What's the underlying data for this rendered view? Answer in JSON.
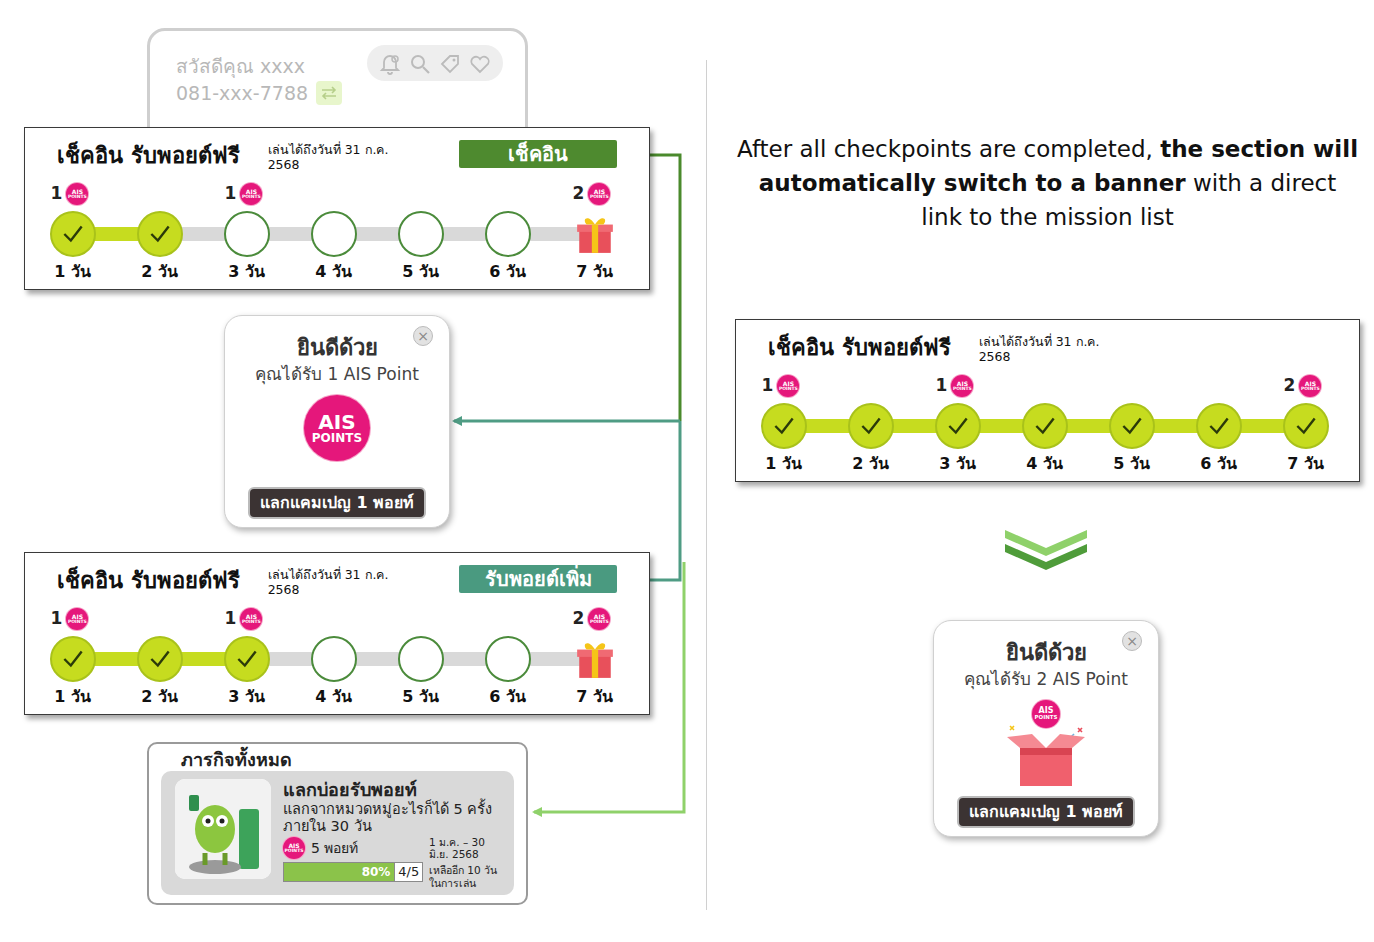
{
  "header": {
    "greeting": "สวัสดีคุณ xxxx",
    "phone": "081-xxx-7788"
  },
  "badge": {
    "line1": "AIS",
    "line2": "POINTS"
  },
  "checkin_cards": [
    {
      "title": "เช็คอิน รับพอยต์ฟรี",
      "note": "เล่นได้ถึงวันที่ 31 ก.ค. 2568",
      "button": "เช็คอิน",
      "button_color": "#4e8a2f",
      "days": [
        {
          "label": "1 วัน",
          "points": "1",
          "done": true,
          "kind": "step"
        },
        {
          "label": "2 วัน",
          "done": true,
          "kind": "step"
        },
        {
          "label": "3 วัน",
          "points": "1",
          "done": false,
          "kind": "step"
        },
        {
          "label": "4 วัน",
          "done": false,
          "kind": "step"
        },
        {
          "label": "5 วัน",
          "done": false,
          "kind": "step"
        },
        {
          "label": "6 วัน",
          "done": false,
          "kind": "step"
        },
        {
          "label": "7 วัน",
          "points": "2",
          "done": false,
          "kind": "gift"
        }
      ]
    },
    {
      "title": "เช็คอิน รับพอยต์ฟรี",
      "note": "เล่นได้ถึงวันที่ 31 ก.ค. 2568",
      "button": "รับพอยต์เพิ่ม",
      "button_color": "#4a9a80",
      "days": [
        {
          "label": "1 วัน",
          "points": "1",
          "done": true,
          "kind": "step"
        },
        {
          "label": "2 วัน",
          "done": true,
          "kind": "step"
        },
        {
          "label": "3 วัน",
          "points": "1",
          "done": true,
          "kind": "step"
        },
        {
          "label": "4 วัน",
          "done": false,
          "kind": "step"
        },
        {
          "label": "5 วัน",
          "done": false,
          "kind": "step"
        },
        {
          "label": "6 วัน",
          "done": false,
          "kind": "step"
        },
        {
          "label": "7 วัน",
          "points": "2",
          "done": false,
          "kind": "gift"
        }
      ]
    },
    {
      "title": "เช็คอิน รับพอยต์ฟรี",
      "note": "เล่นได้ถึงวันที่ 31 ก.ค. 2568",
      "days": [
        {
          "label": "1 วัน",
          "points": "1",
          "done": true,
          "kind": "step"
        },
        {
          "label": "2 วัน",
          "done": true,
          "kind": "step"
        },
        {
          "label": "3 วัน",
          "points": "1",
          "done": true,
          "kind": "step"
        },
        {
          "label": "4 วัน",
          "done": true,
          "kind": "step"
        },
        {
          "label": "5 วัน",
          "done": true,
          "kind": "step"
        },
        {
          "label": "6 วัน",
          "done": true,
          "kind": "step"
        },
        {
          "label": "7 วัน",
          "points": "2",
          "done": true,
          "kind": "step"
        }
      ]
    }
  ],
  "popups": [
    {
      "title": "ยินดีด้วย",
      "message": "คุณได้รับ 1 AIS Point",
      "button": "แลกแคมเปญ 1 พอยท์",
      "close": "×",
      "kind": "coin"
    },
    {
      "title": "ยินดีด้วย",
      "message": "คุณได้รับ 2 AIS Point",
      "button": "แลกแคมเปญ 1 พอยท์",
      "close": "×",
      "kind": "gift"
    }
  ],
  "missions": {
    "heading": "ภารกิจทั้งหมด",
    "items": [
      {
        "title": "แลกบ่อยรับพอยท์",
        "description": "แลกจากหมวดหมู่อะไรก็ได้ 5 ครั้งภายใน 30 วัน",
        "points": "5 พอยท์",
        "period": "1 ม.ค. – 30 มิ.ย. 2568",
        "remaining": "เหลืออีก 10 วันในการเล่น",
        "level": 0.8,
        "percent": "80%",
        "count": "4/5"
      }
    ]
  },
  "note": [
    {
      "text": "After all checkpoints are completed, ",
      "bold": false
    },
    {
      "text": "the section will automatically switch to a banner",
      "bold": true
    },
    {
      "text": " with a direct link to the mission list",
      "bold": false
    }
  ]
}
